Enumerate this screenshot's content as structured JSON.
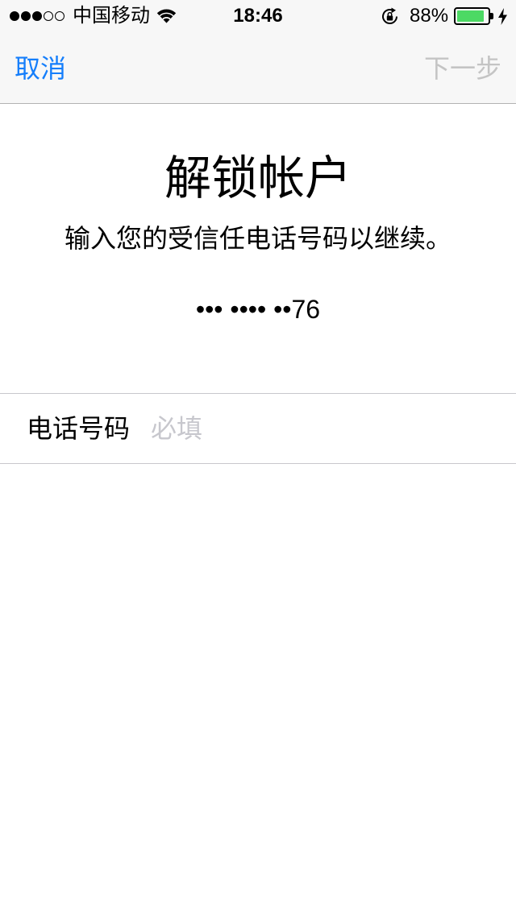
{
  "status_bar": {
    "signal_strength": 3,
    "signal_max": 5,
    "carrier": "中国移动",
    "time": "18:46",
    "battery_percent_text": "88%",
    "battery_level": 0.88,
    "battery_color": "#4cd964",
    "icons": [
      "wifi-icon",
      "rotation-lock-icon",
      "battery-icon",
      "charging-bolt-icon"
    ]
  },
  "nav": {
    "cancel_label": "取消",
    "next_label": "下一步",
    "accent_color": "#157efb",
    "disabled_color": "#c4c4c4"
  },
  "main": {
    "title": "解锁帐户",
    "subtitle": "输入您的受信任电话号码以继续。",
    "masked_phone": "••• •••• ••76"
  },
  "form": {
    "phone_label": "电话号码",
    "phone_value": "",
    "phone_placeholder": "必填"
  }
}
